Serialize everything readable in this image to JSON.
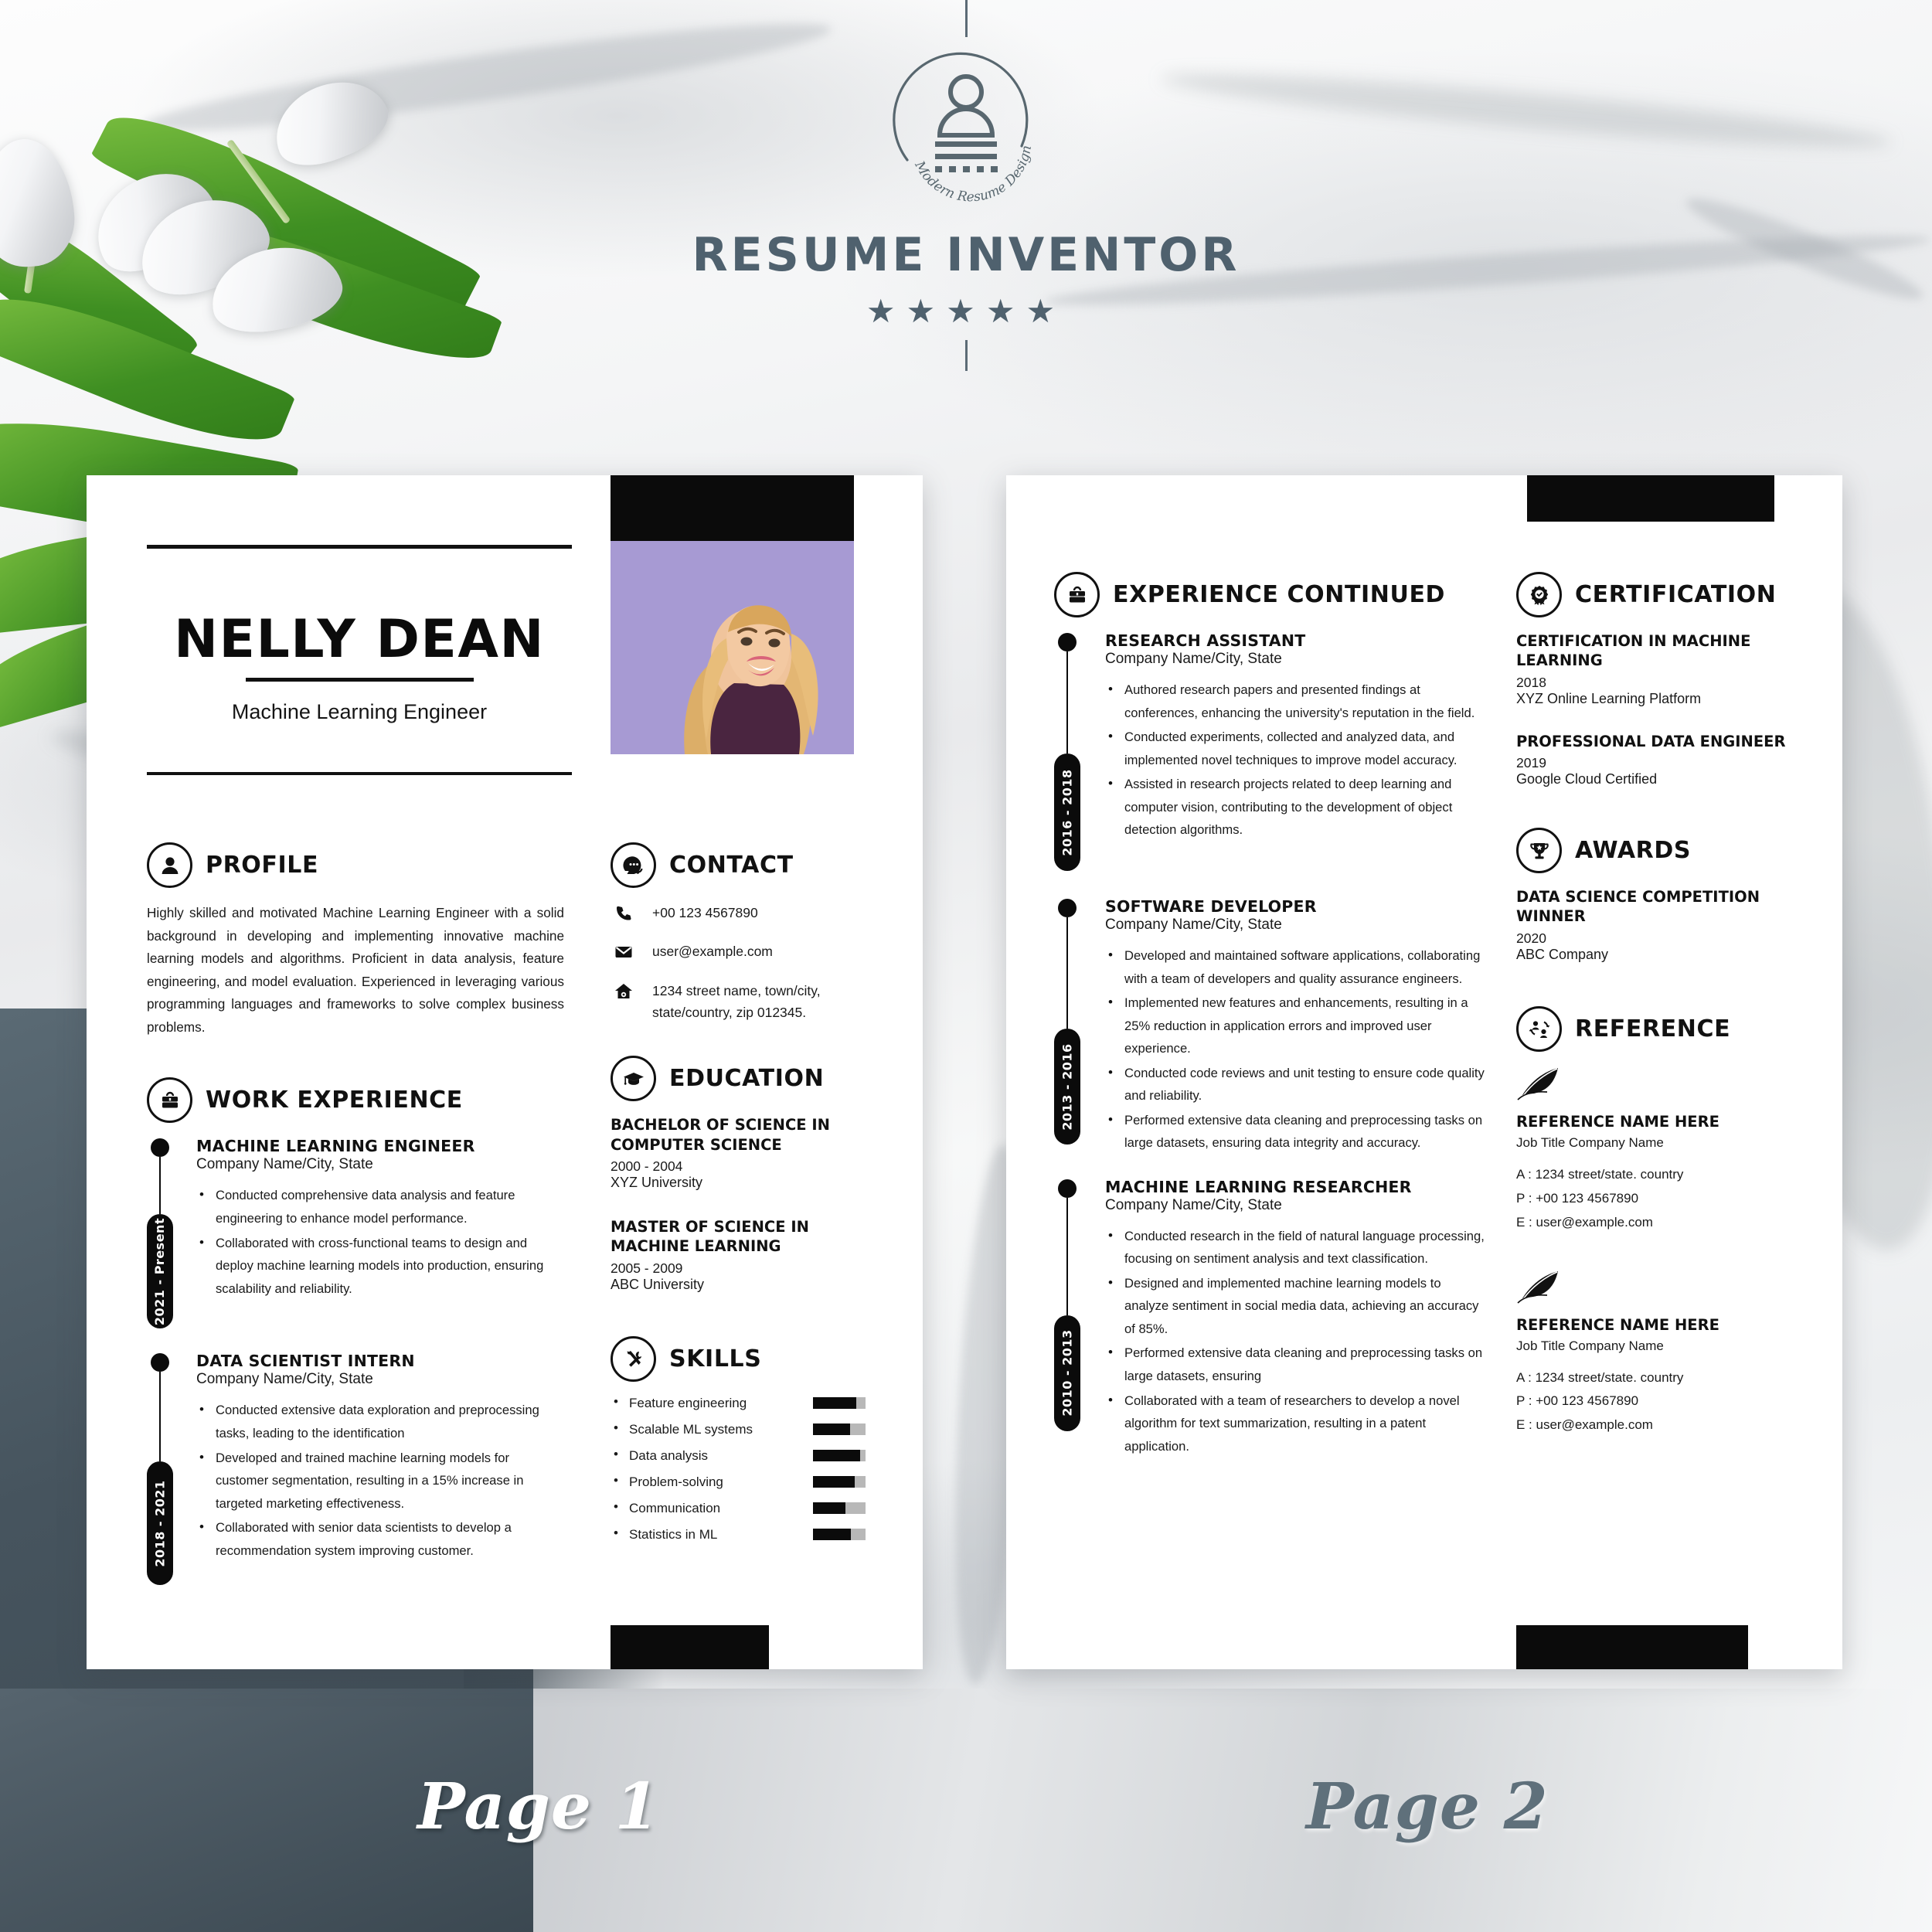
{
  "brand": {
    "name": "RESUME INVENTOR",
    "tagline": "Modern Resume Design",
    "stars": "★★★★★"
  },
  "page_labels": {
    "page1": "Page 1",
    "page2": "Page 2"
  },
  "colors": {
    "ink": "#0b0b0b",
    "brand_slate": "#4f616e",
    "photo_bg": "#a79ad3",
    "skill_track": "#b8b8b8"
  },
  "resume": {
    "header": {
      "name": "NELLY DEAN",
      "title": "Machine Learning Engineer"
    },
    "profile": {
      "heading": "PROFILE",
      "text": "Highly skilled and motivated Machine Learning Engineer with a solid background in developing and implementing innovative machine learning models and algorithms. Proficient in data analysis, feature engineering, and model evaluation. Experienced in leveraging various programming languages and frameworks to solve complex business problems."
    },
    "work_experience": {
      "heading": "WORK EXPERIENCE",
      "items": [
        {
          "period": "2021 - Present",
          "title": "MACHINE LEARNING ENGINEER",
          "company": "Company Name/City, State",
          "bullets": [
            "Conducted comprehensive data analysis and feature engineering to enhance model performance.",
            "Collaborated with cross-functional teams to design and deploy machine learning models into production, ensuring scalability and reliability."
          ]
        },
        {
          "period": "2018 - 2021",
          "title": "DATA SCIENTIST INTERN",
          "company": "Company Name/City, State",
          "bullets": [
            "Conducted extensive data exploration and preprocessing tasks, leading to the identification",
            "Developed and trained machine learning models for customer segmentation, resulting in a 15% increase in targeted marketing effectiveness.",
            "Collaborated with senior data scientists to develop a recommendation system improving customer."
          ]
        }
      ]
    },
    "contact": {
      "heading": "CONTACT",
      "phone": "+00 123 4567890",
      "email": "user@example.com",
      "address": "1234 street name, town/city, state/country, zip 012345."
    },
    "education": {
      "heading": "EDUCATION",
      "items": [
        {
          "degree": "BACHELOR OF SCIENCE IN COMPUTER SCIENCE",
          "years": "2000 - 2004",
          "school": "XYZ University"
        },
        {
          "degree": "MASTER OF SCIENCE IN MACHINE LEARNING",
          "years": "2005 - 2009",
          "school": "ABC University"
        }
      ]
    },
    "skills": {
      "heading": "SKILLS",
      "items": [
        {
          "name": "Feature engineering",
          "level": 82
        },
        {
          "name": "Scalable ML systems",
          "level": 70
        },
        {
          "name": "Data analysis",
          "level": 89
        },
        {
          "name": "Problem-solving",
          "level": 80
        },
        {
          "name": "Communication",
          "level": 62
        },
        {
          "name": "Statistics in ML",
          "level": 72
        }
      ]
    },
    "experience_continued": {
      "heading": "EXPERIENCE CONTINUED",
      "items": [
        {
          "period": "2016 - 2018",
          "title": "RESEARCH ASSISTANT",
          "company": "Company Name/City, State",
          "bullets": [
            "Authored research papers and presented findings at conferences, enhancing the university's reputation in the field.",
            "Conducted experiments, collected and analyzed data, and implemented novel techniques to improve model accuracy.",
            "Assisted in research projects related to deep learning and computer vision, contributing to the development of object detection algorithms."
          ]
        },
        {
          "period": "2013 - 2016",
          "title": "SOFTWARE DEVELOPER",
          "company": "Company Name/City, State",
          "bullets": [
            "Developed and maintained software applications, collaborating with a team of developers and quality assurance engineers.",
            "Implemented new features and enhancements, resulting in a 25% reduction in application errors and improved user experience.",
            "Conducted code reviews and unit testing to ensure code quality and reliability.",
            "Performed extensive data cleaning and preprocessing tasks on large datasets, ensuring data integrity and accuracy."
          ]
        },
        {
          "period": "2010 - 2013",
          "title": "MACHINE LEARNING RESEARCHER",
          "company": "Company Name/City, State",
          "bullets": [
            "Conducted research in the field of natural language processing, focusing on sentiment analysis and text classification.",
            "Designed and implemented machine learning models to analyze sentiment in social media data, achieving an accuracy of 85%.",
            "Performed extensive data cleaning and preprocessing tasks on large datasets, ensuring",
            "Collaborated with a team of researchers to develop a novel algorithm for text summarization, resulting in a patent application."
          ]
        }
      ]
    },
    "certification": {
      "heading": "CERTIFICATION",
      "items": [
        {
          "title": "CERTIFICATION IN MACHINE LEARNING",
          "year": "2018",
          "issuer": "XYZ Online Learning Platform"
        },
        {
          "title": "PROFESSIONAL DATA ENGINEER",
          "year": "2019",
          "issuer": "Google Cloud Certified"
        }
      ]
    },
    "awards": {
      "heading": "AWARDS",
      "items": [
        {
          "title": "DATA SCIENCE COMPETITION WINNER",
          "year": "2020",
          "issuer": "ABC Company"
        }
      ]
    },
    "reference": {
      "heading": "REFERENCE",
      "items": [
        {
          "name": "REFERENCE NAME HERE",
          "job": "Job Title   Company Name",
          "address": "A : 1234 street/state. country",
          "phone": "P : +00 123 4567890",
          "email": "E : user@example.com"
        },
        {
          "name": "REFERENCE NAME HERE",
          "job": "Job Title   Company Name",
          "address": "A : 1234 street/state. country",
          "phone": "P : +00 123 4567890",
          "email": "E : user@example.com"
        }
      ]
    }
  }
}
